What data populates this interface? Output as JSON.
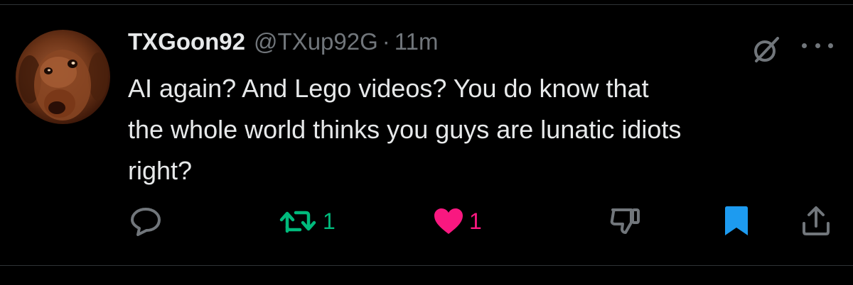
{
  "tweet": {
    "display_name": "TXGoon92",
    "handle": "@TXup92G",
    "separator": "·",
    "time": "11m",
    "text": "AI again?  And Lego videos?  You do know that\nthe whole world thinks you guys are lunatic idiots\nright?"
  },
  "icons": {
    "avatar": "dog-photo-avatar",
    "grok": "grok-icon",
    "more": "more-icon",
    "reply": "reply-icon",
    "retweet": "retweet-icon",
    "like": "heart-icon",
    "dislike": "thumbs-down-icon",
    "bookmark": "bookmark-icon",
    "share": "share-icon"
  },
  "actions": {
    "retweet_count": "1",
    "like_count": "1"
  },
  "colors": {
    "background": "#000000",
    "text": "#e7e9ea",
    "muted": "#71767b",
    "retweet_active": "#00ba7c",
    "like_active": "#f91880",
    "bookmark_active": "#1d9bf0"
  }
}
